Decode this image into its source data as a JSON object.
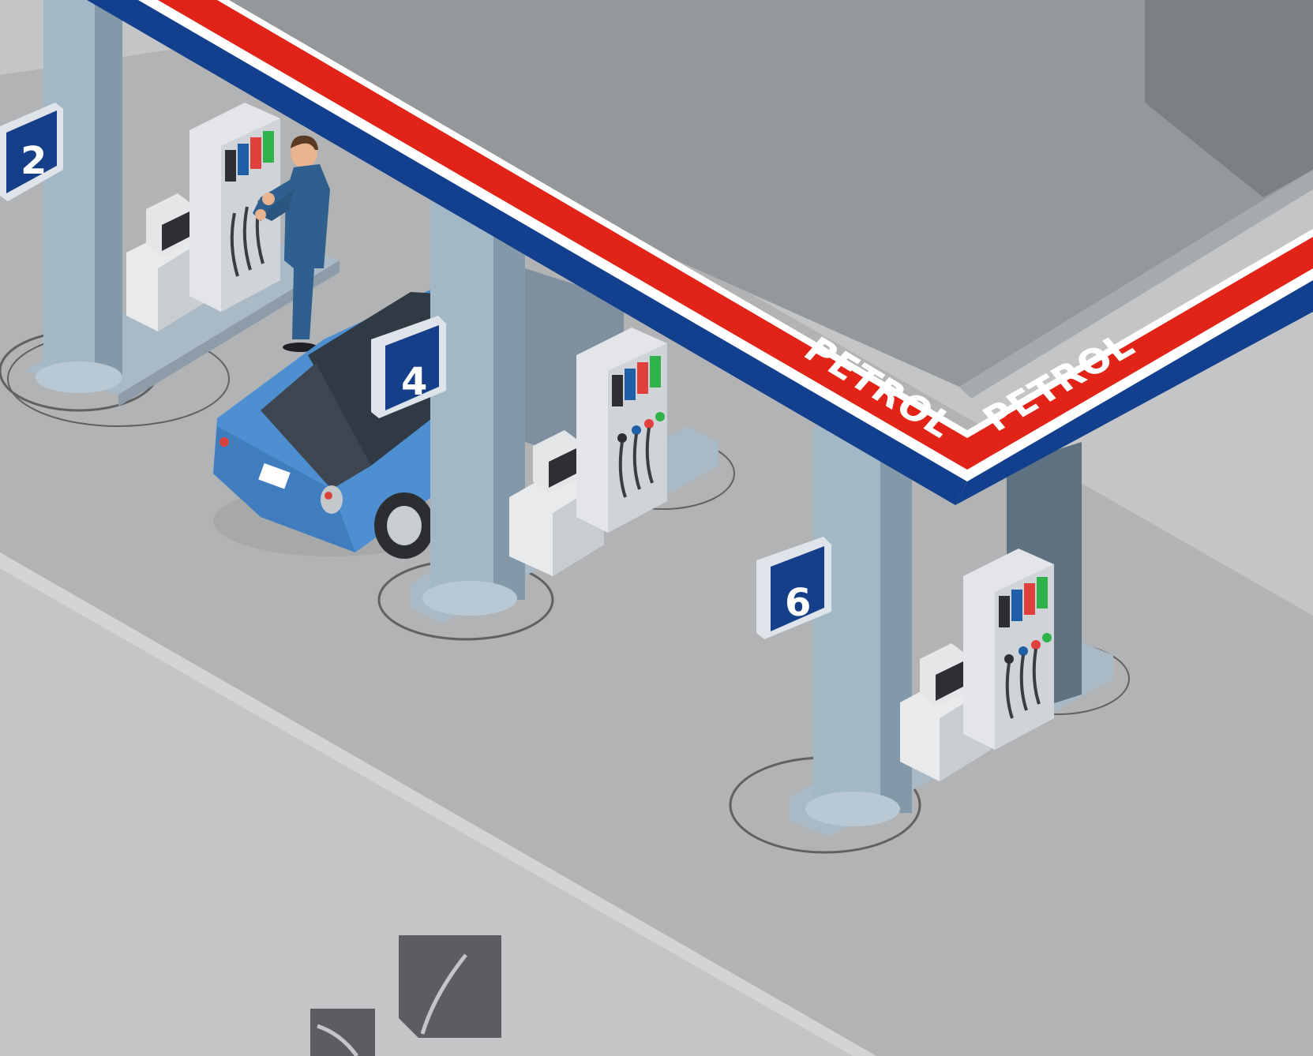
{
  "canopy": {
    "brand_left": "PETROL",
    "brand_right": "PETROL"
  },
  "pumps": [
    {
      "number": "2"
    },
    {
      "number": "4"
    },
    {
      "number": "6"
    }
  ],
  "dispenser_fuel_colors": [
    "#2d2f33",
    "#1f5fa8",
    "#e2403c",
    "#2fb24a"
  ],
  "colors": {
    "canopy_red": "#e22317",
    "canopy_blue": "#13408e",
    "canopy_top": "#95989a",
    "pavement": "#b2b3b5",
    "ground": "#c4c5c7",
    "car_blue": "#4d8fd0",
    "sign_blue": "#163f8a"
  }
}
